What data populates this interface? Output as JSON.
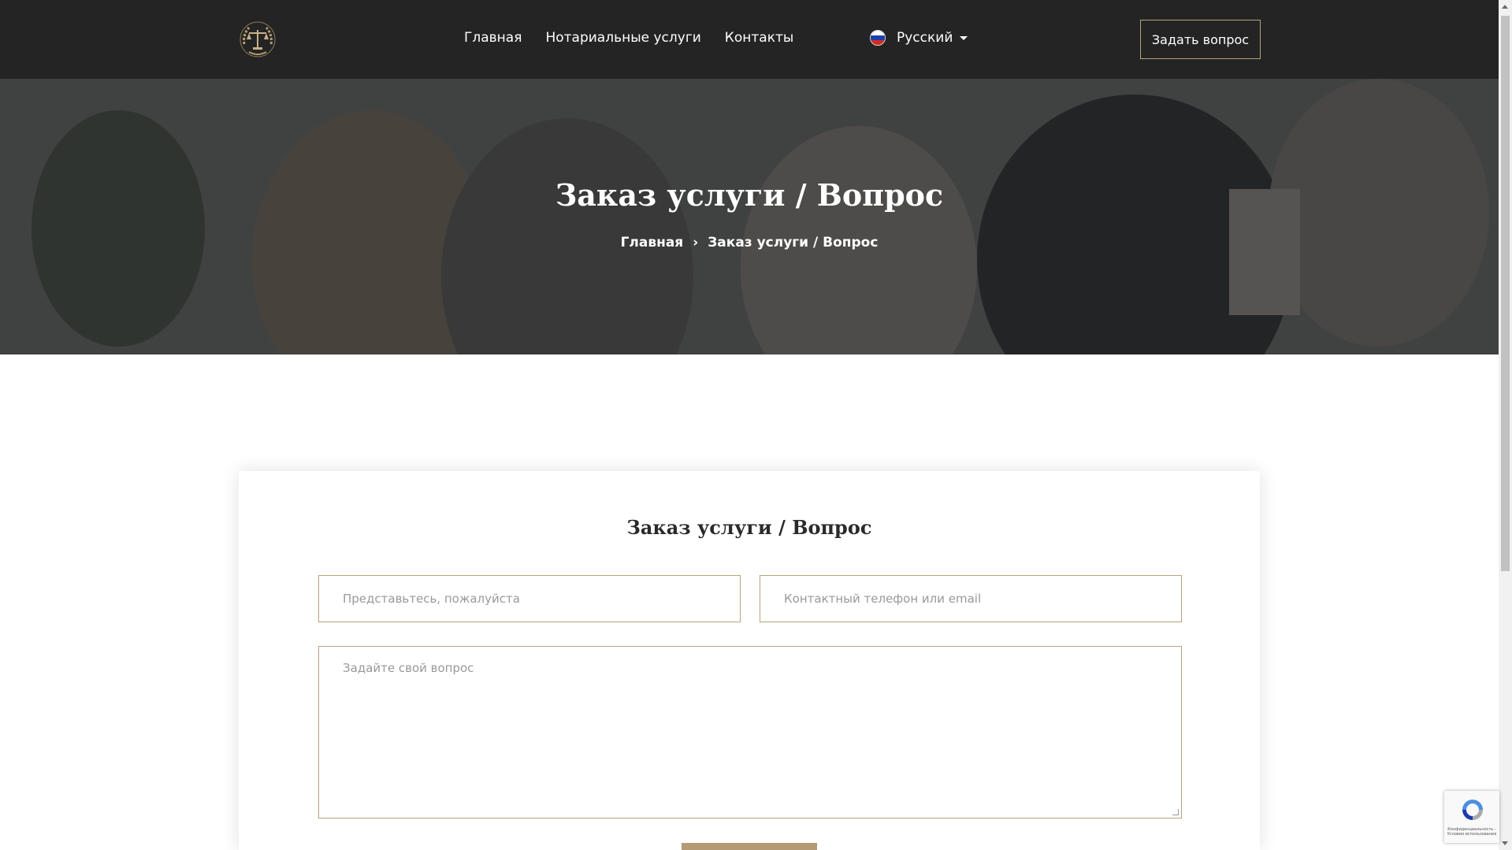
{
  "header": {
    "logo_icon": "scales-of-justice-laurel-icon",
    "nav": [
      {
        "label": "Главная"
      },
      {
        "label": "Нотариальные услуги"
      },
      {
        "label": "Контакты"
      }
    ],
    "language": {
      "label": "Русский",
      "flag_icon": "russia-flag-icon"
    },
    "ask_button": "Задать вопрос"
  },
  "hero": {
    "title": "Заказ услуги / Вопрос",
    "breadcrumb": {
      "home": "Главная",
      "current": "Заказ услуги / Вопрос"
    }
  },
  "form": {
    "title": "Заказ услуги / Вопрос",
    "name_placeholder": "Представьтесь, пожалуйста",
    "contact_placeholder": "Контактный телефон или email",
    "question_placeholder": "Задайте свой вопрос"
  },
  "recaptcha": {
    "text": "Конфиденциальность - Условия использования"
  },
  "colors": {
    "header_bg": "#242424",
    "accent": "#b49b73",
    "border": "#b9a37f"
  }
}
